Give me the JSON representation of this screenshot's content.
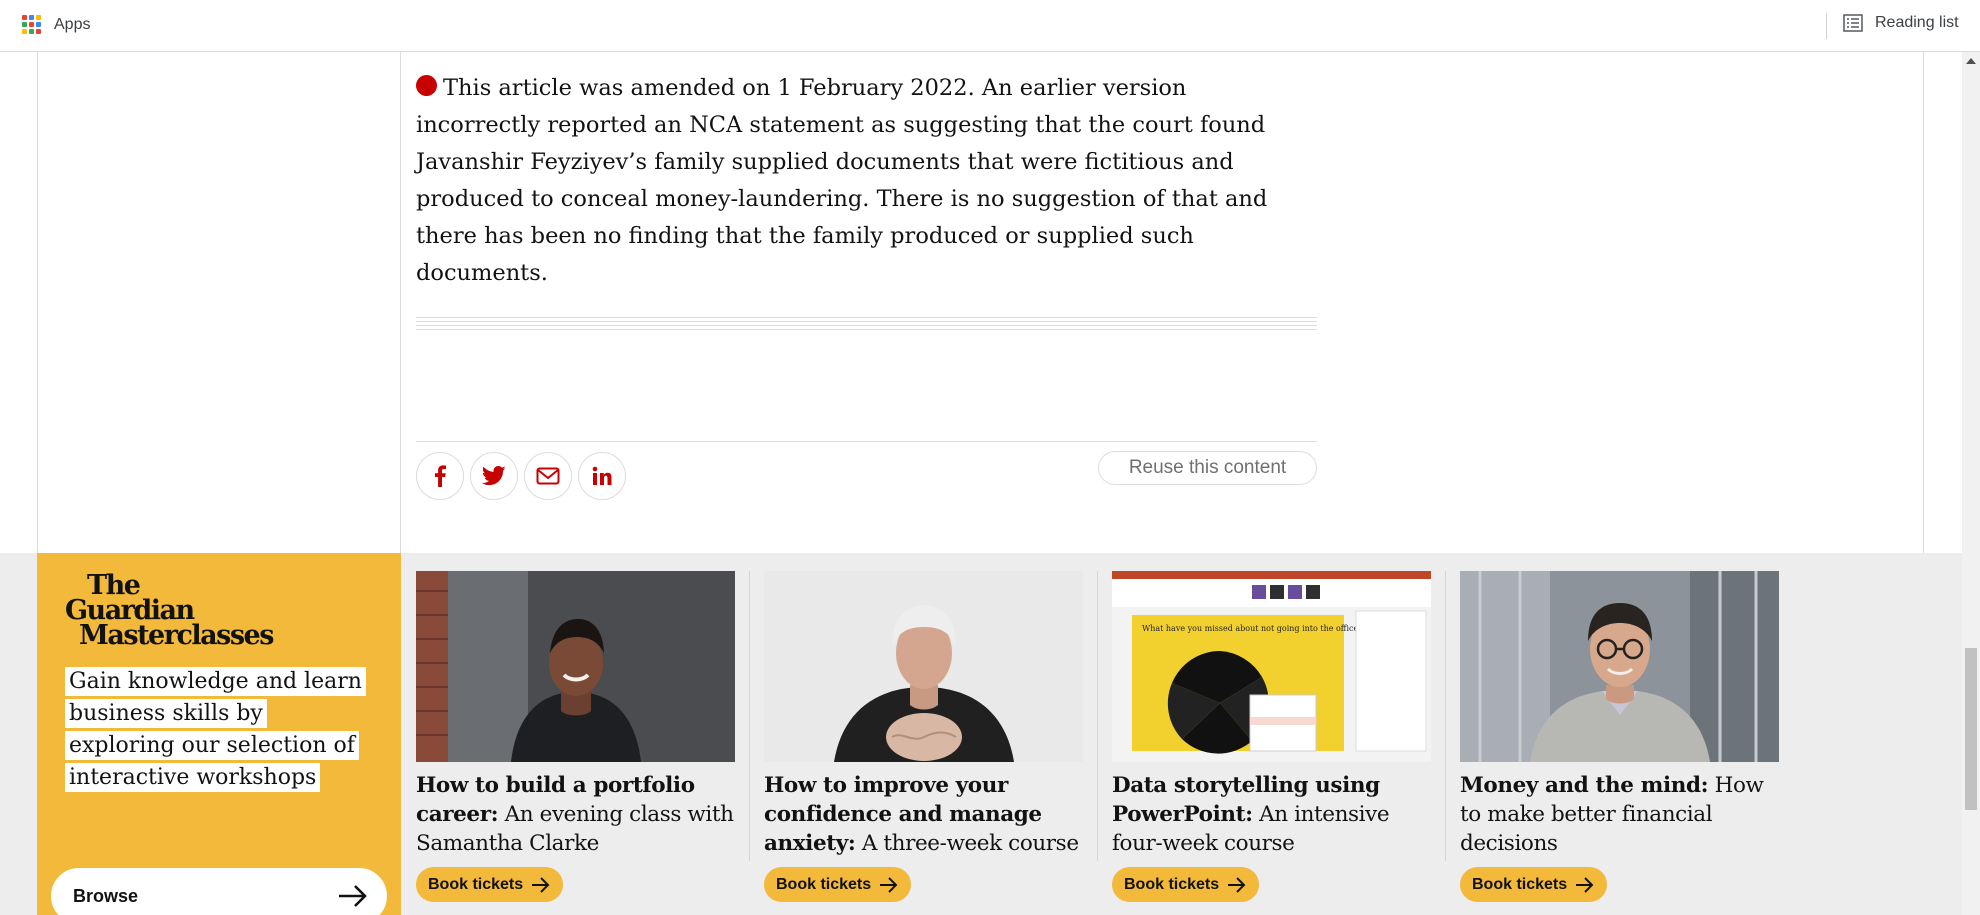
{
  "browser": {
    "apps_label": "Apps",
    "reading_list_label": "Reading list"
  },
  "correction": {
    "text": "This article was amended on 1 February 2022. An earlier version incorrectly reported an NCA statement as suggesting that the court found Javanshir Feyziyev’s family supplied documents that were fictitious and produced to conceal money-laundering. There is no suggestion of that and there has been no finding that the family produced or supplied such documents."
  },
  "share": {
    "icons": [
      "facebook-icon",
      "twitter-icon",
      "email-icon",
      "linkedin-icon"
    ],
    "reuse_label": "Reuse this content"
  },
  "masterclasses": {
    "logo_lines": [
      "The",
      "Guardian",
      "Masterclasses"
    ],
    "tagline": "Gain knowledge and learn business skills by exploring our selection of interactive workshops",
    "browse_label": "Browse",
    "cards": [
      {
        "bold": "How to build a portfolio career:",
        "rest": " An evening class with Samantha Clarke",
        "button": "Book tickets"
      },
      {
        "bold": "How to improve your confidence and manage anxiety:",
        "rest": " A three-week course",
        "button": "Book tickets"
      },
      {
        "bold": "Data storytelling using PowerPoint:",
        "rest": " An intensive four-week course",
        "button": "Book tickets"
      },
      {
        "bold": "Money and the mind:",
        "rest": " How to make better financial decisions",
        "button": "Book tickets"
      }
    ],
    "slide_question": "What have you missed about not going into the office?"
  },
  "colors": {
    "accent_yellow": "#f3b93a",
    "correction_red": "#c70000",
    "strip_background": "#ededed"
  }
}
